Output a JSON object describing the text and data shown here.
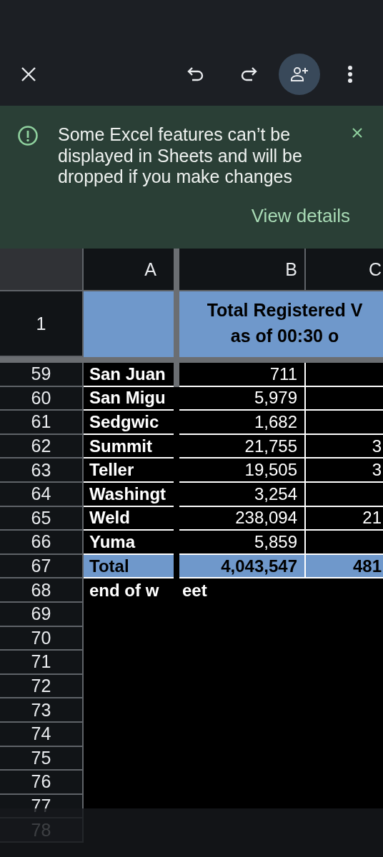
{
  "banner": {
    "message": "Some Excel features can’t be displayed in Sheets and will be dropped if you make changes",
    "action": "View details"
  },
  "sheet": {
    "columns": [
      "A",
      "B",
      "C"
    ],
    "title_row": {
      "number": "1",
      "lines": [
        "Total Registered V",
        "as of 00:30 o"
      ]
    },
    "rows": [
      {
        "number": "59",
        "kind": "data",
        "a": "San Juan",
        "b": "711"
      },
      {
        "number": "60",
        "kind": "data",
        "a": "San Migu",
        "b": "5,979"
      },
      {
        "number": "61",
        "kind": "data",
        "a": "Sedgwic",
        "b": "1,682"
      },
      {
        "number": "62",
        "kind": "data",
        "a": "Summit",
        "b": "21,755",
        "c": "3"
      },
      {
        "number": "63",
        "kind": "data",
        "a": "Teller",
        "b": "19,505",
        "c": "3"
      },
      {
        "number": "64",
        "kind": "data",
        "a": "Washingt",
        "b": "3,254"
      },
      {
        "number": "65",
        "kind": "data",
        "a": "Weld",
        "b": "238,094",
        "c": "21"
      },
      {
        "number": "66",
        "kind": "data",
        "a": "Yuma",
        "b": "5,859"
      },
      {
        "number": "67",
        "kind": "total",
        "a": "Total",
        "b": "4,043,547",
        "c": "481"
      },
      {
        "number": "68",
        "kind": "note",
        "a": "end of w",
        "b": "eet"
      },
      {
        "number": "69",
        "kind": "empty"
      },
      {
        "number": "70",
        "kind": "empty"
      },
      {
        "number": "71",
        "kind": "empty"
      },
      {
        "number": "72",
        "kind": "empty"
      },
      {
        "number": "73",
        "kind": "empty"
      },
      {
        "number": "74",
        "kind": "empty"
      },
      {
        "number": "75",
        "kind": "empty"
      },
      {
        "number": "76",
        "kind": "empty"
      },
      {
        "number": "77",
        "kind": "empty"
      },
      {
        "number": "78",
        "kind": "empty"
      }
    ]
  }
}
